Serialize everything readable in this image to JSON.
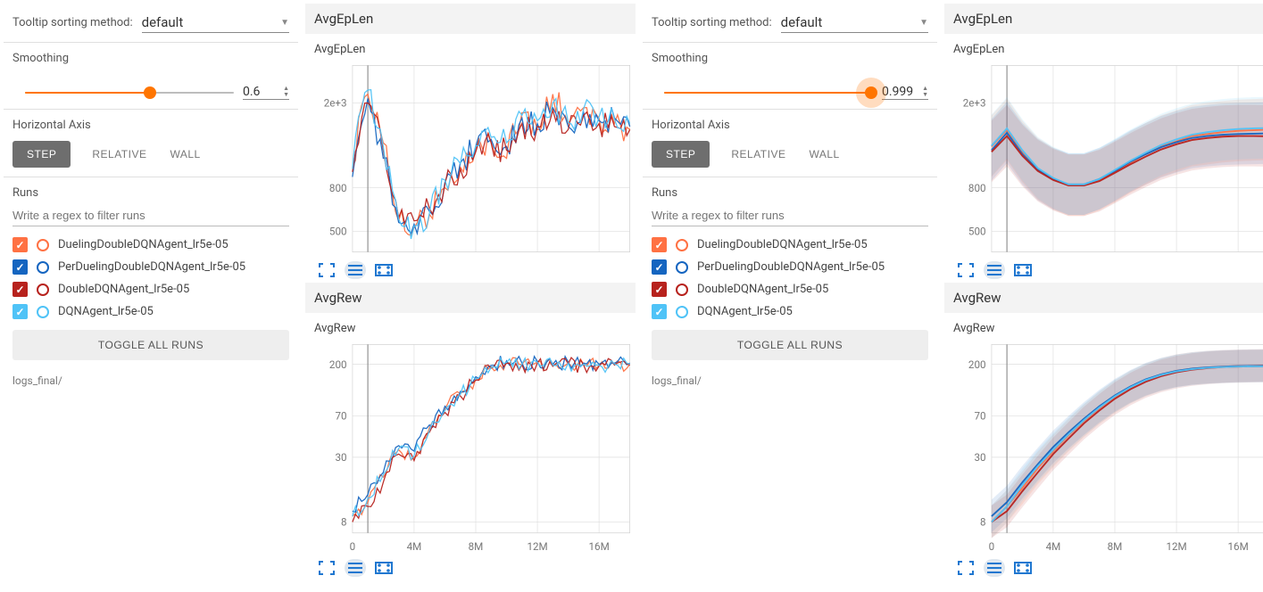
{
  "colors": {
    "run0": "#ff7143",
    "run1": "#1565c0",
    "run2": "#b7221d",
    "run3": "#4fc3f7"
  },
  "tooltip": {
    "label": "Tooltip sorting method:",
    "selected": "default"
  },
  "smoothing": {
    "label": "Smoothing"
  },
  "horiz": {
    "label": "Horizontal Axis",
    "step": "STEP",
    "relative": "RELATIVE",
    "wall": "WALL"
  },
  "runs": {
    "label": "Runs",
    "placeholder": "Write a regex to filter runs",
    "items": [
      {
        "name": "DuelingDoubleDQNAgent_lr5e-05",
        "color": "#ff7143",
        "ring": "#ff7143"
      },
      {
        "name": "PerDuelingDoubleDQNAgent_lr5e-05",
        "color": "#1565c0",
        "ring": "#1565c0"
      },
      {
        "name": "DoubleDQNAgent_lr5e-05",
        "color": "#b7221d",
        "ring": "#b7221d"
      },
      {
        "name": "DQNAgent_lr5e-05",
        "color": "#4fc3f7",
        "ring": "#4fc3f7"
      }
    ],
    "toggle": "TOGGLE ALL RUNS",
    "path": "logs_final/"
  },
  "panels": [
    {
      "smoothing_value": "0.6",
      "slider_pct": 60,
      "halo": false
    },
    {
      "smoothing_value": "0.999",
      "slider_pct": 99,
      "halo": true
    }
  ],
  "sections": {
    "eplen": "AvgEpLen",
    "rew": "AvgRew"
  },
  "xticks": [
    "0",
    "4M",
    "8M",
    "12M",
    "16M"
  ],
  "chart_data": [
    {
      "id": "eplen_low_smooth",
      "type": "line",
      "title": "AvgEpLen",
      "x": [
        0,
        1,
        2,
        3,
        4,
        5,
        6,
        7,
        8,
        9,
        10,
        11,
        12,
        13,
        14,
        15,
        16,
        17,
        18
      ],
      "yticks": [
        500,
        800,
        2000
      ],
      "series": [
        {
          "name": "DuelingDoubleDQNAgent_lr5e-05",
          "color": "#ff7143",
          "values": [
            1000,
            2200,
            1300,
            560,
            520,
            600,
            800,
            1000,
            1200,
            1300,
            1100,
            1800,
            1500,
            2200,
            1600,
            1900,
            1700,
            1600,
            1500
          ]
        },
        {
          "name": "PerDuelingDoubleDQNAgent_lr5e-05",
          "color": "#1565c0",
          "values": [
            900,
            2100,
            1100,
            550,
            540,
            620,
            850,
            1050,
            1250,
            1350,
            1250,
            1700,
            1600,
            1900,
            1550,
            1800,
            1650,
            1700,
            1550
          ]
        },
        {
          "name": "DoubleDQNAgent_lr5e-05",
          "color": "#b7221d",
          "values": [
            950,
            2000,
            1200,
            580,
            560,
            640,
            830,
            980,
            1180,
            1300,
            1200,
            1600,
            1550,
            1850,
            1500,
            1750,
            1600,
            1550,
            1500
          ]
        },
        {
          "name": "DQNAgent_lr5e-05",
          "color": "#4fc3f7",
          "values": [
            980,
            2300,
            1250,
            570,
            530,
            610,
            870,
            1040,
            1260,
            1380,
            1300,
            1750,
            1650,
            2000,
            1620,
            1880,
            1720,
            1680,
            1600
          ]
        }
      ]
    },
    {
      "id": "eplen_high_smooth",
      "type": "line",
      "title": "AvgEpLen",
      "x": [
        0,
        1,
        2,
        3,
        4,
        5,
        6,
        7,
        8,
        9,
        10,
        11,
        12,
        13,
        14,
        15,
        16,
        17,
        18
      ],
      "yticks": [
        500,
        800,
        2000
      ],
      "series": [
        {
          "name": "DuelingDoubleDQNAgent_lr5e-05",
          "color": "#ff7143",
          "values": [
            1250,
            1500,
            1180,
            980,
            880,
            820,
            820,
            870,
            950,
            1050,
            1150,
            1250,
            1320,
            1400,
            1430,
            1460,
            1480,
            1490,
            1500
          ]
        },
        {
          "name": "PerDuelingDoubleDQNAgent_lr5e-05",
          "color": "#1565c0",
          "values": [
            1200,
            1450,
            1150,
            970,
            880,
            830,
            830,
            880,
            960,
            1060,
            1150,
            1240,
            1310,
            1370,
            1400,
            1420,
            1430,
            1435,
            1440
          ]
        },
        {
          "name": "DoubleDQNAgent_lr5e-05",
          "color": "#b7221d",
          "values": [
            1180,
            1400,
            1130,
            960,
            870,
            820,
            820,
            860,
            940,
            1030,
            1120,
            1210,
            1280,
            1340,
            1370,
            1390,
            1400,
            1400,
            1395
          ]
        },
        {
          "name": "DQNAgent_lr5e-05",
          "color": "#4fc3f7",
          "values": [
            1260,
            1520,
            1200,
            990,
            890,
            830,
            830,
            880,
            970,
            1070,
            1170,
            1270,
            1350,
            1420,
            1460,
            1490,
            1510,
            1520,
            1525
          ]
        }
      ]
    },
    {
      "id": "rew_low_smooth",
      "type": "line",
      "title": "AvgRew",
      "x": [
        0,
        1,
        2,
        3,
        4,
        5,
        6,
        7,
        8,
        9,
        10,
        11,
        12,
        13,
        14,
        15,
        16,
        17,
        18
      ],
      "yticks": [
        8,
        30,
        70,
        200
      ],
      "series": [
        {
          "name": "DuelingDoubleDQNAgent_lr5e-05",
          "color": "#ff7143",
          "values": [
            9,
            12,
            20,
            35,
            30,
            55,
            80,
            110,
            150,
            190,
            210,
            200,
            210,
            195,
            205,
            200,
            195,
            200,
            200
          ]
        },
        {
          "name": "PerDuelingDoubleDQNAgent_lr5e-05",
          "color": "#1565c0",
          "values": [
            10,
            14,
            22,
            38,
            34,
            58,
            85,
            115,
            155,
            195,
            215,
            205,
            212,
            200,
            210,
            205,
            200,
            205,
            205
          ]
        },
        {
          "name": "DoubleDQNAgent_lr5e-05",
          "color": "#b7221d",
          "values": [
            8,
            11,
            18,
            32,
            28,
            50,
            75,
            105,
            145,
            185,
            205,
            198,
            206,
            192,
            202,
            197,
            193,
            197,
            197
          ]
        },
        {
          "name": "DQNAgent_lr5e-05",
          "color": "#4fc3f7",
          "values": [
            9,
            13,
            21,
            36,
            31,
            52,
            78,
            108,
            148,
            188,
            208,
            201,
            209,
            196,
            205,
            201,
            197,
            201,
            201
          ]
        }
      ]
    },
    {
      "id": "rew_high_smooth",
      "type": "line",
      "title": "AvgRew",
      "x": [
        0,
        1,
        2,
        3,
        4,
        5,
        6,
        7,
        8,
        9,
        10,
        11,
        12,
        13,
        14,
        15,
        16,
        17,
        18
      ],
      "yticks": [
        8,
        30,
        70,
        200
      ],
      "series": [
        {
          "name": "DuelingDoubleDQNAgent_lr5e-05",
          "color": "#ff7143",
          "values": [
            8,
            11,
            16,
            24,
            34,
            47,
            63,
            82,
            103,
            125,
            145,
            162,
            175,
            183,
            188,
            191,
            193,
            194,
            195
          ]
        },
        {
          "name": "PerDuelingDoubleDQNAgent_lr5e-05",
          "color": "#1565c0",
          "values": [
            9,
            12,
            18,
            26,
            37,
            50,
            66,
            85,
            106,
            127,
            147,
            163,
            175,
            183,
            188,
            191,
            193,
            194,
            195
          ]
        },
        {
          "name": "DoubleDQNAgent_lr5e-05",
          "color": "#b7221d",
          "values": [
            8,
            10,
            15,
            22,
            32,
            44,
            60,
            78,
            99,
            120,
            140,
            157,
            170,
            179,
            185,
            189,
            191,
            192,
            193
          ]
        },
        {
          "name": "DQNAgent_lr5e-05",
          "color": "#4fc3f7",
          "values": [
            8,
            11,
            17,
            25,
            35,
            48,
            64,
            83,
            104,
            125,
            145,
            161,
            173,
            181,
            186,
            189,
            191,
            192,
            192
          ]
        }
      ]
    }
  ]
}
